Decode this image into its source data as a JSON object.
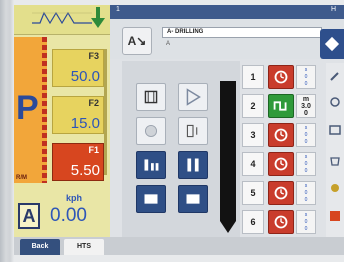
{
  "window": {
    "top_left_number": "1",
    "top_right_letter": "H"
  },
  "header": {
    "sort_button_label": "A↘",
    "program_name": "A- DRILLING",
    "program_sub": "A",
    "nav_icon": "diamond-icon"
  },
  "left_panel": {
    "gear_letter": "P",
    "feeds": [
      {
        "label": "F3",
        "value": "50.0",
        "active": false
      },
      {
        "label": "F2",
        "value": "15.0",
        "active": false
      },
      {
        "label": "F1",
        "value": "5.50",
        "active": true
      }
    ],
    "small_tick_label": "R/M",
    "speed": {
      "mode_letter": "A",
      "unit": "kph",
      "value": "0.00"
    }
  },
  "controls": {
    "buttons": [
      {
        "name": "tramline-icon",
        "style": "light"
      },
      {
        "name": "play-icon",
        "style": "light"
      },
      {
        "name": "circle-icon",
        "style": "light"
      },
      {
        "name": "marker-icon",
        "style": "light"
      },
      {
        "name": "section-left-icon",
        "style": "dark"
      },
      {
        "name": "pause-icon",
        "style": "dark"
      },
      {
        "name": "stop-left-icon",
        "style": "dark"
      },
      {
        "name": "stop-right-icon",
        "style": "dark"
      }
    ]
  },
  "sections": [
    {
      "number": "1",
      "icon": "clock-icon",
      "state": "red",
      "line1": "s",
      "line2": "0",
      "line3": "0"
    },
    {
      "number": "2",
      "icon": "wave-icon",
      "state": "green",
      "line1": "m",
      "line2": "3.0",
      "line3": "0"
    },
    {
      "number": "3",
      "icon": "clock-icon",
      "state": "red",
      "line1": "s",
      "line2": "0",
      "line3": "0"
    },
    {
      "number": "4",
      "icon": "clock-icon",
      "state": "red",
      "line1": "s",
      "line2": "0",
      "line3": "0"
    },
    {
      "number": "5",
      "icon": "clock-icon",
      "state": "red",
      "line1": "s",
      "line2": "0",
      "line3": "0"
    },
    {
      "number": "6",
      "icon": "clock-icon",
      "state": "red",
      "line1": "s",
      "line2": "0",
      "line3": "0"
    }
  ],
  "tabs": [
    {
      "label": "Back",
      "selected": false
    },
    {
      "label": "HTS",
      "selected": true
    }
  ],
  "colors": {
    "accent_blue": "#2f4f86",
    "feed_yellow": "#e7d35f",
    "active_red": "#d7461f",
    "panel_orange": "#f2a63a",
    "section_red": "#c93c2c",
    "section_green": "#2f9a3a"
  }
}
